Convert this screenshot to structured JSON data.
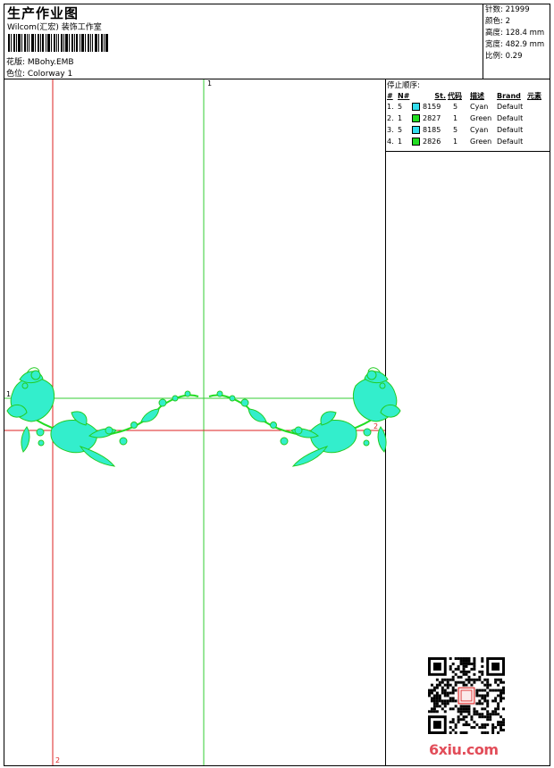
{
  "header": {
    "title": "生产作业图",
    "subtitle": "Wilcom(汇宏) 装饰工作室",
    "design_label": "花版: MBohy.EMB",
    "colorway_label": "色位: Colorway 1"
  },
  "stats": {
    "stitches": "针数: 21999",
    "colors": "颜色: 2",
    "height": "高度: 128.4 mm",
    "width": "宽度: 482.9 mm",
    "scale": "比例: 0.29"
  },
  "stop_sequence": {
    "caption": "停止顺序:",
    "columns": [
      "#",
      "N#",
      "St.",
      "代码",
      "描述",
      "Brand",
      "元素"
    ],
    "rows": [
      {
        "idx": "1.",
        "n": "5",
        "color": "#33ddee",
        "st": "8159",
        "code": "5",
        "desc": "Cyan",
        "brand": "Default"
      },
      {
        "idx": "2.",
        "n": "1",
        "color": "#22dd22",
        "st": "2827",
        "code": "1",
        "desc": "Green",
        "brand": "Default"
      },
      {
        "idx": "3.",
        "n": "5",
        "color": "#33ddee",
        "st": "8185",
        "code": "5",
        "desc": "Cyan",
        "brand": "Default"
      },
      {
        "idx": "4.",
        "n": "1",
        "color": "#22dd22",
        "st": "2826",
        "code": "1",
        "desc": "Green",
        "brand": "Default"
      }
    ]
  },
  "guides": {
    "green_vertical_label": "1",
    "green_horizontal_label": "1",
    "red_horizontal_label": "2",
    "red_vertical_label": "2"
  },
  "colors": {
    "cyan": "#33eecc",
    "green": "#22dd22",
    "guide_green": "#33cc33",
    "guide_red": "#dd2222",
    "watermark": "#e24d59"
  },
  "watermark": "6xiu.com"
}
